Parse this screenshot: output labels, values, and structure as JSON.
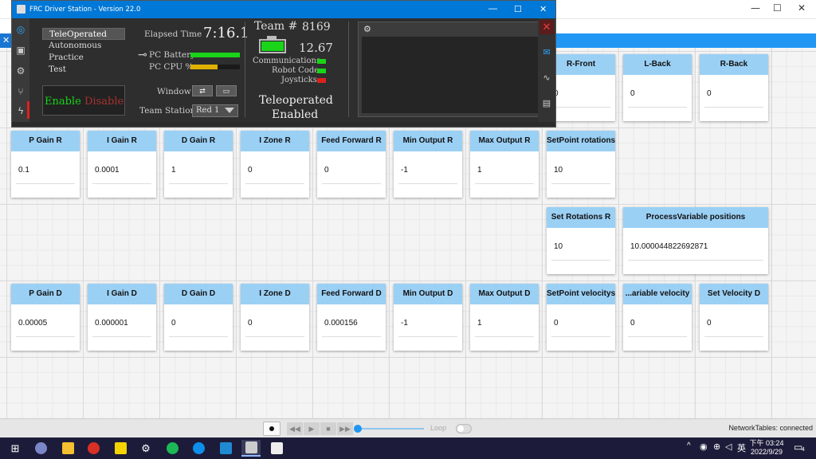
{
  "shuffleboard": {
    "window_controls": {
      "min": "—",
      "max": "☐",
      "close": "✕"
    },
    "tab_left_label": "✕ S",
    "tiles": [
      {
        "title": "R-Front",
        "value": "0"
      },
      {
        "title": "L-Back",
        "value": "0"
      },
      {
        "title": "R-Back",
        "value": "0"
      },
      {
        "title": "P Gain R",
        "value": "0.1"
      },
      {
        "title": "I Gain R",
        "value": "0.0001"
      },
      {
        "title": "D Gain R",
        "value": "1"
      },
      {
        "title": "I Zone R",
        "value": "0"
      },
      {
        "title": "Feed Forward R",
        "value": "0"
      },
      {
        "title": "Min Output R",
        "value": "-1"
      },
      {
        "title": "Max Output R",
        "value": "1"
      },
      {
        "title": "SetPoint rotations",
        "value": "10"
      },
      {
        "title": "Set Rotations R",
        "value": "10"
      },
      {
        "title": "ProcessVariable positions",
        "value": "10.000044822692871"
      },
      {
        "title": "P Gain D",
        "value": "0.00005"
      },
      {
        "title": "I Gain D",
        "value": "0.000001"
      },
      {
        "title": "D Gain D",
        "value": "0"
      },
      {
        "title": "I Zone D",
        "value": "0"
      },
      {
        "title": "Feed Forward D",
        "value": "0.000156"
      },
      {
        "title": "Min Output D",
        "value": "-1"
      },
      {
        "title": "Max Output D",
        "value": "1"
      },
      {
        "title": "SetPoint velocitys",
        "value": "0"
      },
      {
        "title": "...ariable velocity",
        "value": "0"
      },
      {
        "title": "Set Velocity D",
        "value": "0"
      }
    ],
    "bottom": {
      "loop_label": "Loop",
      "nt_status": "NetworkTables: connected"
    }
  },
  "driver_station": {
    "title": "FRC Driver Station - Version 22.0",
    "window_controls": {
      "min": "—",
      "max": "☐",
      "close": "✕"
    },
    "modes": [
      "TeleOperated",
      "Autonomous",
      "Practice",
      "Test"
    ],
    "selected_mode": "TeleOperated",
    "enable_label": "Enable",
    "disable_label": "Disable",
    "elapsed_label": "Elapsed Time",
    "elapsed_value": "7:16.1",
    "pc_battery_label": "PC Battery",
    "pc_battery_level": 1.0,
    "pc_cpu_label": "PC CPU %",
    "pc_cpu_level": 0.55,
    "window_label": "Window",
    "team_station_label": "Team Station",
    "team_station_value": "Red 1",
    "team_label": "Team #",
    "team_number": "8169",
    "battery_voltage": "12.67",
    "communications_label": "Communications",
    "robot_code_label": "Robot Code",
    "joysticks_label": "Joysticks",
    "status_line1": "Teleoperated",
    "status_line2": "Enabled",
    "colors": {
      "green": "#19d419",
      "red": "#e02020",
      "yellow": "#e0b000",
      "accent": "#0078d7"
    }
  },
  "taskbar": {
    "ime": "英",
    "clock_time": "下午 03:24",
    "clock_date": "2022/9/29",
    "notification_count": "4"
  }
}
